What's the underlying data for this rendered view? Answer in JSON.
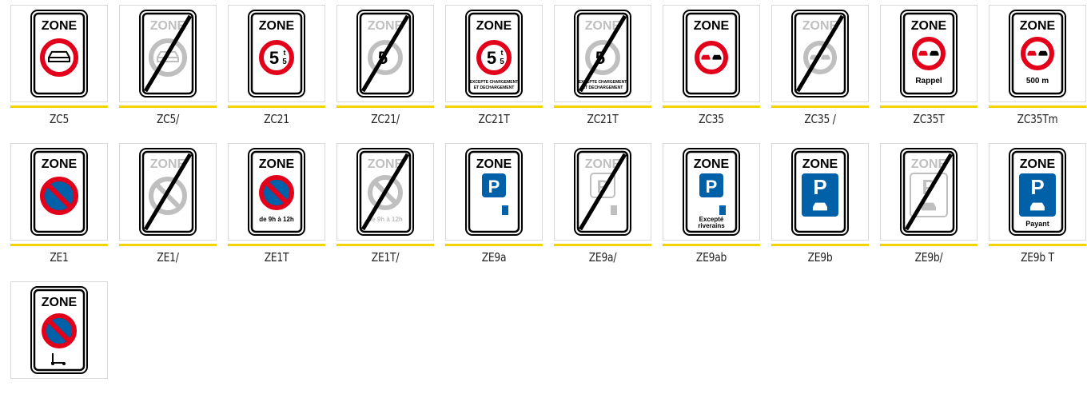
{
  "colors": {
    "red": "#e2001a",
    "blue": "#0060a8",
    "accent_line": "#f2d600",
    "faded": "#bfbfbf"
  },
  "signs": [
    [
      {
        "code": "ZC5",
        "kind": "noentry-car",
        "zone": "ZONE"
      },
      {
        "code": "ZC5/",
        "kind": "noentry-car-end",
        "zone": "ZONE"
      },
      {
        "code": "ZC21",
        "kind": "weight",
        "zone": "ZONE",
        "weight": "5",
        "unit_top": "t",
        "unit_bot": "5"
      },
      {
        "code": "ZC21/",
        "kind": "weight-end",
        "zone": "ZONE",
        "weight": "5"
      },
      {
        "code": "ZC21T",
        "kind": "weight-text",
        "zone": "ZONE",
        "weight": "5",
        "unit_top": "t",
        "unit_bot": "5",
        "sub1": "EXCEPTE CHARGEMENT",
        "sub2": "ET DECHARGEMENT"
      },
      {
        "code": "ZC21T",
        "kind": "weight-text-end",
        "zone": "ZONE",
        "weight": "5",
        "sub1": "EXCEPTE CHARGEMENT",
        "sub2": "ET DECHARGEMENT"
      },
      {
        "code": "ZC35",
        "kind": "overtake",
        "zone": "ZONE"
      },
      {
        "code": "ZC35 /",
        "kind": "overtake-end",
        "zone": "ZONE"
      },
      {
        "code": "ZC35T",
        "kind": "overtake-text",
        "zone": "ZONE",
        "sub": "Rappel"
      },
      {
        "code": "ZC35Tm",
        "kind": "overtake-text",
        "zone": "ZONE",
        "sub": "500 m"
      }
    ],
    [
      {
        "code": "ZE1",
        "kind": "noparking",
        "zone": "ZONE"
      },
      {
        "code": "ZE1/",
        "kind": "noparking-end",
        "zone": "ZONE"
      },
      {
        "code": "ZE1T",
        "kind": "noparking-text",
        "zone": "ZONE",
        "sub": "de 9h à 12h"
      },
      {
        "code": "ZE1T/",
        "kind": "noparking-text-end",
        "zone": "ZONE",
        "sub": "de 9h à 12h"
      },
      {
        "code": "ZE9a",
        "kind": "parking-meter",
        "zone": "ZONE",
        "p": "P"
      },
      {
        "code": "ZE9a/",
        "kind": "parking-meter-end",
        "zone": "ZONE",
        "p": "P"
      },
      {
        "code": "ZE9ab",
        "kind": "parking-riverains",
        "zone": "ZONE",
        "p": "P",
        "sub1": "Excepté",
        "sub2": "riverains"
      },
      {
        "code": "ZE9b",
        "kind": "parking-car",
        "zone": "ZONE",
        "p": "P"
      },
      {
        "code": "ZE9b/",
        "kind": "parking-car-end",
        "zone": "ZONE",
        "p": "P"
      },
      {
        "code": "ZE9b T",
        "kind": "parking-payant",
        "zone": "ZONE",
        "p": "P",
        "sub": "Payant"
      }
    ],
    [
      {
        "code": "",
        "kind": "noparking-scooter",
        "zone": "ZONE"
      }
    ]
  ]
}
